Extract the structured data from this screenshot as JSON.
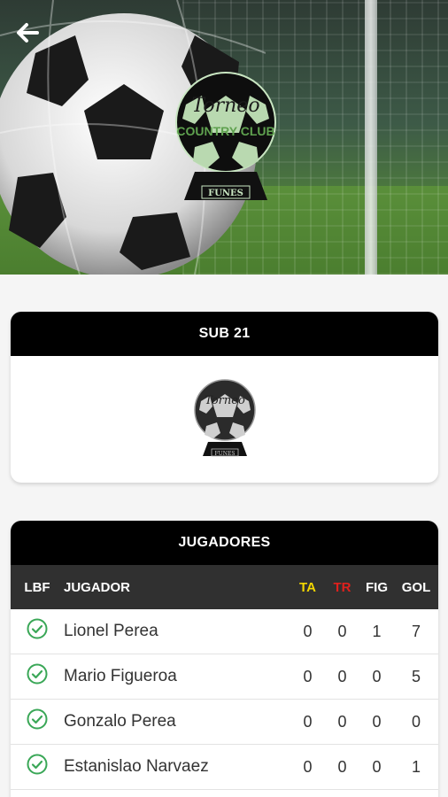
{
  "hero": {
    "logo": {
      "line1": "Torneo",
      "line2": "COUNTRY CLUB",
      "ribbon": "FUNES"
    }
  },
  "nav": {
    "back_icon": "arrow-left-icon"
  },
  "team_card": {
    "title": "SUB 21"
  },
  "players_card": {
    "title": "JUGADORES",
    "headers": {
      "lbf": "LBF",
      "name": "JUGADOR",
      "ta": "TA",
      "tr": "TR",
      "fig": "FIG",
      "gol": "GOL"
    },
    "rows": [
      {
        "name": "Lionel Perea",
        "ta": "0",
        "tr": "0",
        "fig": "1",
        "gol": "7"
      },
      {
        "name": "Mario Figueroa",
        "ta": "0",
        "tr": "0",
        "fig": "0",
        "gol": "5"
      },
      {
        "name": "Gonzalo Perea",
        "ta": "0",
        "tr": "0",
        "fig": "0",
        "gol": "0"
      },
      {
        "name": "Estanislao Narvaez",
        "ta": "0",
        "tr": "0",
        "fig": "0",
        "gol": "1"
      }
    ]
  },
  "colors": {
    "accent_check": "#3aa757",
    "yellow_card": "#f2d600",
    "red_card": "#e0201c"
  }
}
